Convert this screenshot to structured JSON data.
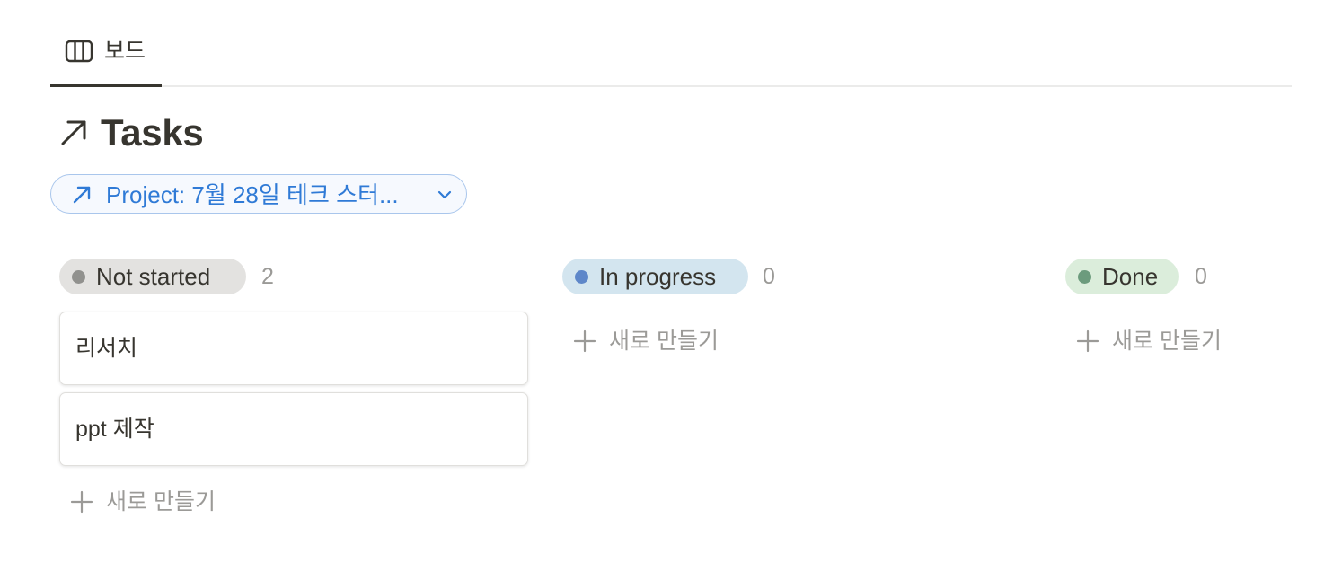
{
  "view_tabs": [
    {
      "label": "보드",
      "icon": "board-columns-icon"
    }
  ],
  "database": {
    "title": "Tasks",
    "title_icon": "arrow-up-right-icon"
  },
  "filter": {
    "label": "Project: 7월 28일 테크 스터...",
    "icon": "arrow-up-right-icon",
    "dropdown_icon": "chevron-down-icon",
    "color": "#2f7ad6"
  },
  "board": {
    "columns": [
      {
        "status": "Not started",
        "count": "2",
        "dot_color": "#91918e",
        "badge_bg": "#e3e2e0",
        "cards": [
          {
            "title": "리서치"
          },
          {
            "title": "ppt 제작"
          }
        ],
        "new_label": "새로 만들기"
      },
      {
        "status": "In progress",
        "count": "0",
        "dot_color": "#5e87c9",
        "badge_bg": "#d3e5ef",
        "cards": [],
        "new_label": "새로 만들기"
      },
      {
        "status": "Done",
        "count": "0",
        "dot_color": "#6c9b7d",
        "badge_bg": "#dbeddb",
        "cards": [],
        "new_label": "새로 만들기"
      }
    ]
  }
}
